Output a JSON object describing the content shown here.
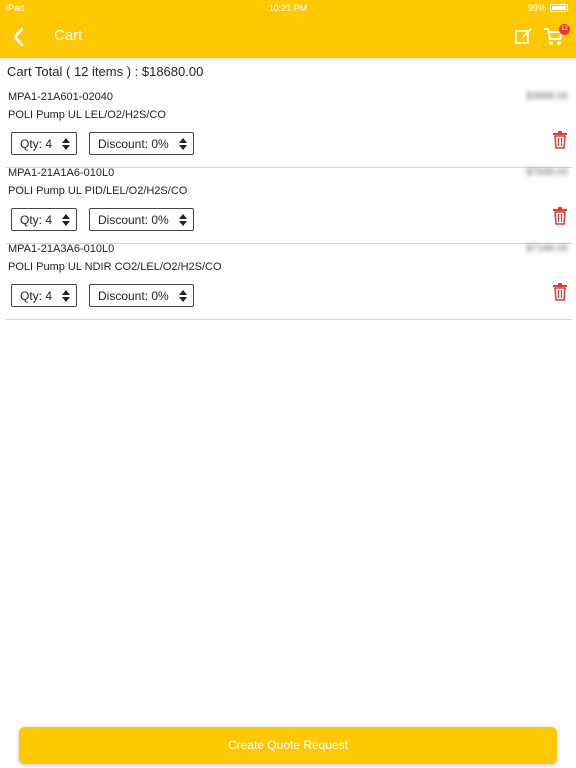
{
  "status_bar": {
    "carrier": "iPad",
    "time": "10:21 PM",
    "battery": "99%"
  },
  "nav": {
    "title": "Cart",
    "cart_badge": "12"
  },
  "cart_total": "Cart Total ( 12 items ) : $18680.00",
  "items": [
    {
      "sku": "MPA1-21A601-02040",
      "name": "POLI Pump UL LEL/O2/H2S/CO",
      "price": "$3888.00",
      "qty": "Qty: 4",
      "discount": "Discount: 0%"
    },
    {
      "sku": "MPA1-21A1A6-010L0",
      "name": "POLI Pump UL PID/LEL/O2/H2S/CO",
      "price": "$7688.00",
      "qty": "Qty: 4",
      "discount": "Discount: 0%"
    },
    {
      "sku": "MPA1-21A3A6-010L0",
      "name": "POLI Pump UL NDIR CO2/LEL/O2/H2S/CO",
      "price": "$7188.00",
      "qty": "Qty: 4",
      "discount": "Discount: 0%"
    }
  ],
  "cta_label": "Create Quote Request",
  "colors": {
    "accent": "#FEC800",
    "delete": "#e53935"
  }
}
